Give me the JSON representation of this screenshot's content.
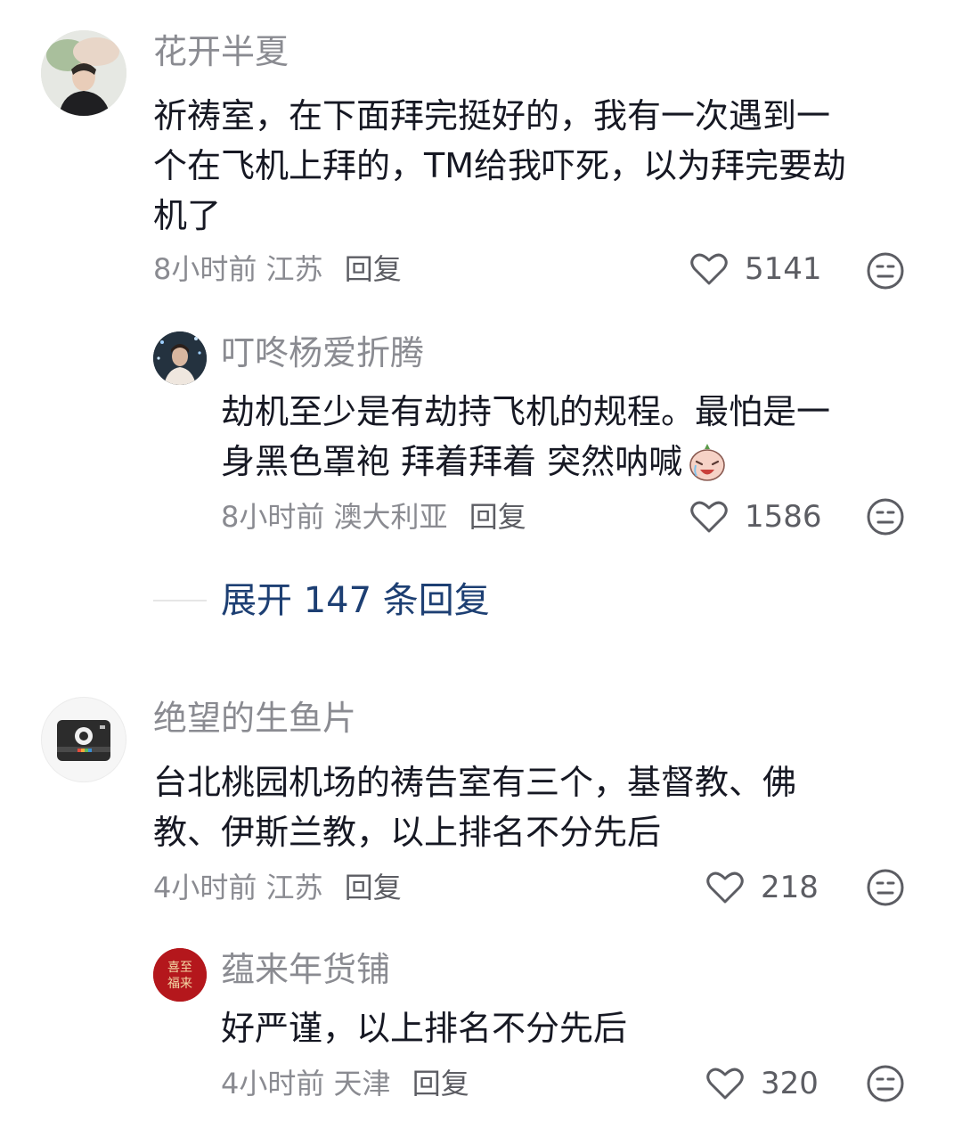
{
  "comments": [
    {
      "name": "花开半夏",
      "line1": "祈祷室，在下面拜完挺好的，我有一次遇到一",
      "line2": "个在飞机上拜的，TM给我吓死，以为拜完要劫",
      "line3": "机了",
      "time": "8小时前",
      "location": "江苏",
      "reply_label": "回复",
      "likes": "5141",
      "avatar_icon": "portrait-avatar-icon",
      "reply": {
        "name": "叮咚杨爱折腾",
        "line1": "劫机至少是有劫持飞机的规程。最怕是一",
        "line2": "身黑色罩袍 拜着拜着 突然呐喊",
        "emoji_icon": "crying-emoji-icon",
        "time": "8小时前",
        "location": "澳大利亚",
        "reply_label": "回复",
        "likes": "1586"
      },
      "expand_label": "展开 147 条回复"
    },
    {
      "name": "绝望的生鱼片",
      "line1": "台北桃园机场的祷告室有三个，基督教、佛",
      "line2": "教、伊斯兰教，以上排名不分先后",
      "time": "4小时前",
      "location": "江苏",
      "reply_label": "回复",
      "likes": "218",
      "avatar_icon": "camera-avatar-icon",
      "reply": {
        "name": "蕴来年货铺",
        "line1": "好严谨，以上排名不分先后",
        "time": "4小时前",
        "location": "天津",
        "reply_label": "回复",
        "likes": "320",
        "avatar_text_1": "喜至",
        "avatar_text_2": "福来"
      }
    }
  ],
  "colors": {
    "name": "#8a8b91",
    "text": "#161823",
    "expand": "#1d3f73"
  }
}
